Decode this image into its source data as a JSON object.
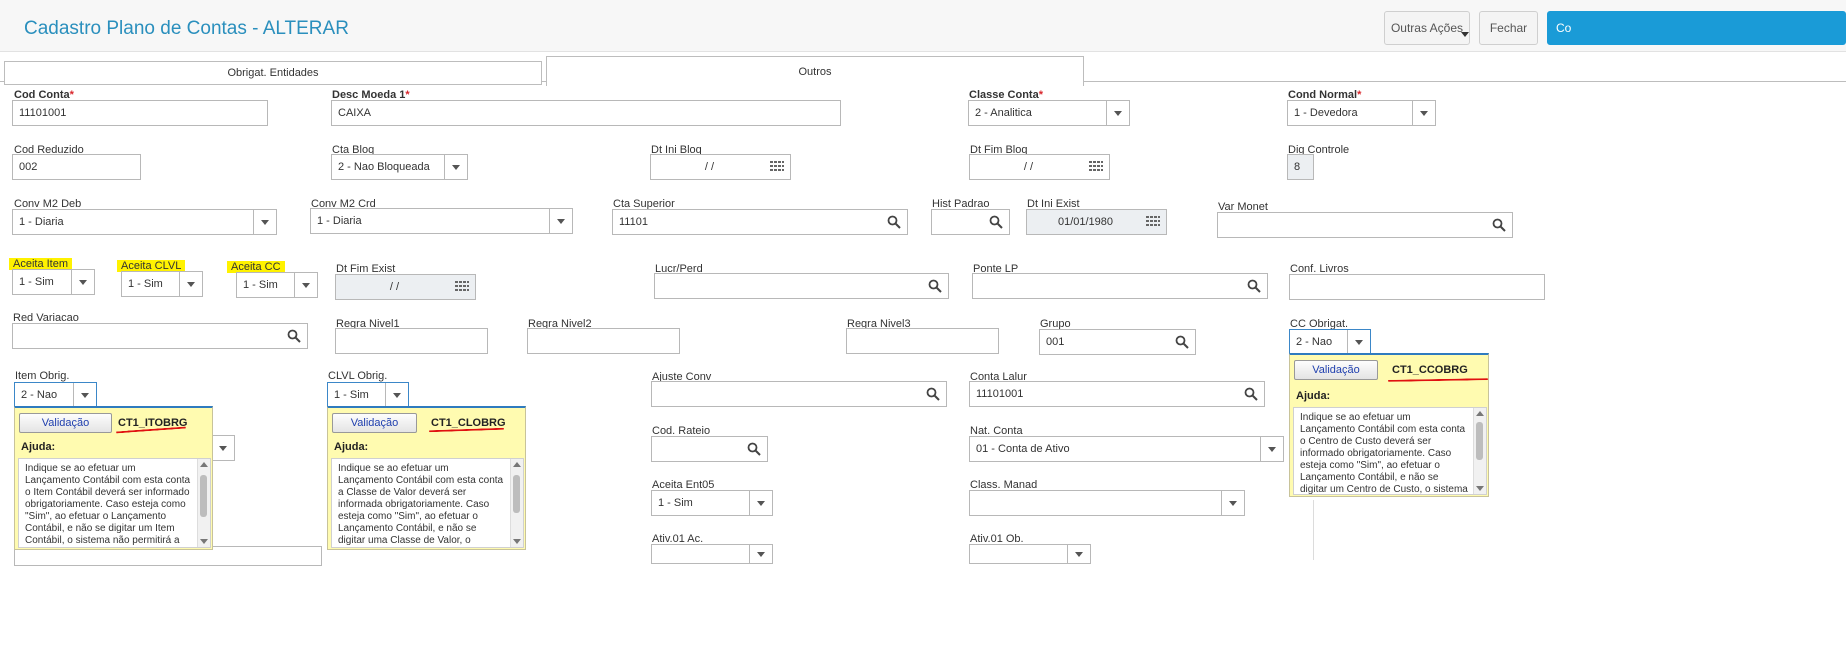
{
  "header": {
    "title": "Cadastro Plano de Contas - ALTERAR",
    "outras_acoes": "Outras Ações",
    "fechar": "Fechar",
    "confirmar_partial": "Co"
  },
  "tabs": [
    {
      "label": "Obrigat. Entidades",
      "active": false
    },
    {
      "label": "Outros",
      "active": true
    }
  ],
  "fields": {
    "cod_conta": {
      "label": "Cod Conta",
      "value": "11101001"
    },
    "desc_moeda": {
      "label": "Desc Moeda 1",
      "value": "CAIXA"
    },
    "classe_conta": {
      "label": "Classe Conta",
      "value": "2 - Analitica"
    },
    "cond_normal": {
      "label": "Cond Normal",
      "value": "1 - Devedora"
    },
    "cod_reduzido": {
      "label": "Cod Reduzido",
      "value": "002"
    },
    "cta_bloq": {
      "label": "Cta Bloq",
      "value": "2 - Nao Bloqueada"
    },
    "dt_ini_bloq": {
      "label": "Dt Ini Bloq",
      "value": "/ /"
    },
    "dt_fim_bloq": {
      "label": "Dt Fim Bloq",
      "value": "/ /"
    },
    "dig_controle": {
      "label": "Dig Controle",
      "value": "8"
    },
    "conv_m2_deb": {
      "label": "Conv M2 Deb",
      "value": "1 - Diaria"
    },
    "conv_m2_crd": {
      "label": "Conv M2 Crd",
      "value": "1 - Diaria"
    },
    "cta_superior": {
      "label": "Cta Superior",
      "value": "11101"
    },
    "hist_padrao": {
      "label": "Hist Padrao",
      "value": ""
    },
    "dt_ini_exist": {
      "label": "Dt Ini Exist",
      "value": "01/01/1980"
    },
    "var_monet": {
      "label": "Var Monet",
      "value": ""
    },
    "aceita_item": {
      "label": "Aceita Item",
      "value": "1 - Sim"
    },
    "aceita_clvl": {
      "label": "Aceita CLVL",
      "value": "1 - Sim"
    },
    "aceita_cc": {
      "label": "Aceita CC",
      "value": "1 - Sim"
    },
    "dt_fim_exist": {
      "label": "Dt Fim Exist",
      "value": "/ /"
    },
    "lucr_perd": {
      "label": "Lucr/Perd",
      "value": ""
    },
    "ponte_lp": {
      "label": "Ponte LP",
      "value": ""
    },
    "conf_livros": {
      "label": "Conf. Livros",
      "value": ""
    },
    "red_variacao": {
      "label": "Red Variacao",
      "value": ""
    },
    "regra_nivel1": {
      "label": "Regra Nivel1",
      "value": ""
    },
    "regra_nivel2": {
      "label": "Regra Nivel2",
      "value": ""
    },
    "regra_nivel3": {
      "label": "Regra Nivel3",
      "value": ""
    },
    "grupo": {
      "label": "Grupo",
      "value": "001"
    },
    "cc_obrig": {
      "label": "CC Obrigat.",
      "value": "2 - Nao"
    },
    "item_obrig": {
      "label": "Item Obrig.",
      "value": "2 - Nao"
    },
    "clvl_obrig": {
      "label": "CLVL Obrig.",
      "value": "1 - Sim"
    },
    "ajuste_conv": {
      "label": "Ajuste Conv",
      "value": ""
    },
    "conta_lalur": {
      "label": "Conta Lalur",
      "value": "11101001"
    },
    "cod_rateio": {
      "label": "Cod. Rateio",
      "value": ""
    },
    "nat_conta": {
      "label": "Nat. Conta",
      "value": "01 - Conta de Ativo"
    },
    "aceita_ent05": {
      "label": "Aceita Ent05",
      "value": "1 - Sim"
    },
    "class_manad": {
      "label": "Class. Manad",
      "value": ""
    },
    "ativ01_ac": {
      "label": "Ativ.01 Ac.",
      "value": ""
    },
    "ativ01_ob": {
      "label": "Ativ.01 Ob.",
      "value": ""
    }
  },
  "popups": {
    "itobrg": {
      "button": "Validação",
      "title": "CT1_ITOBRG",
      "ajuda": "Ajuda:",
      "text": "Indique se ao efetuar um Lançamento Contábil com esta conta o Item Contábil deverá ser informado obrigatoriamente. Caso esteja como \"Sim\", ao efetuar o Lançamento Contábil, e não se digitar um Item Contábil, o sistema não permitirá a gravação enquanto o mesmo não for"
    },
    "clobrg": {
      "button": "Validação",
      "title": "CT1_CLOBRG",
      "ajuda": "Ajuda:",
      "text": "Indique se ao efetuar um Lançamento Contábil com esta conta a Classe de Valor deverá ser informada obrigatoriamente. Caso esteja como \"Sim\", ao efetuar o Lançamento Contábil, e não se digitar uma Classe de Valor, o sistema não"
    },
    "ccobrg": {
      "button": "Validação",
      "title": "CT1_CCOBRG",
      "ajuda": "Ajuda:",
      "text": "Indique se ao efetuar um Lançamento Contábil com esta conta o Centro de Custo deverá ser informado obrigatoriamente. Caso esteja como \"Sim\", ao efetuar o Lançamento Contábil, e não se digitar um Centro de Custo, o sistema não permitirá"
    }
  },
  "colors": {
    "accent": "#1a9bd7",
    "title": "#2a8fbd",
    "required": "#d9262c",
    "highlight": "#fff200",
    "popup_bg": "#fffbb0",
    "annotation_red": "#e01010"
  },
  "icons": [
    "search-icon",
    "calendar-icon",
    "chevron-down-icon"
  ]
}
